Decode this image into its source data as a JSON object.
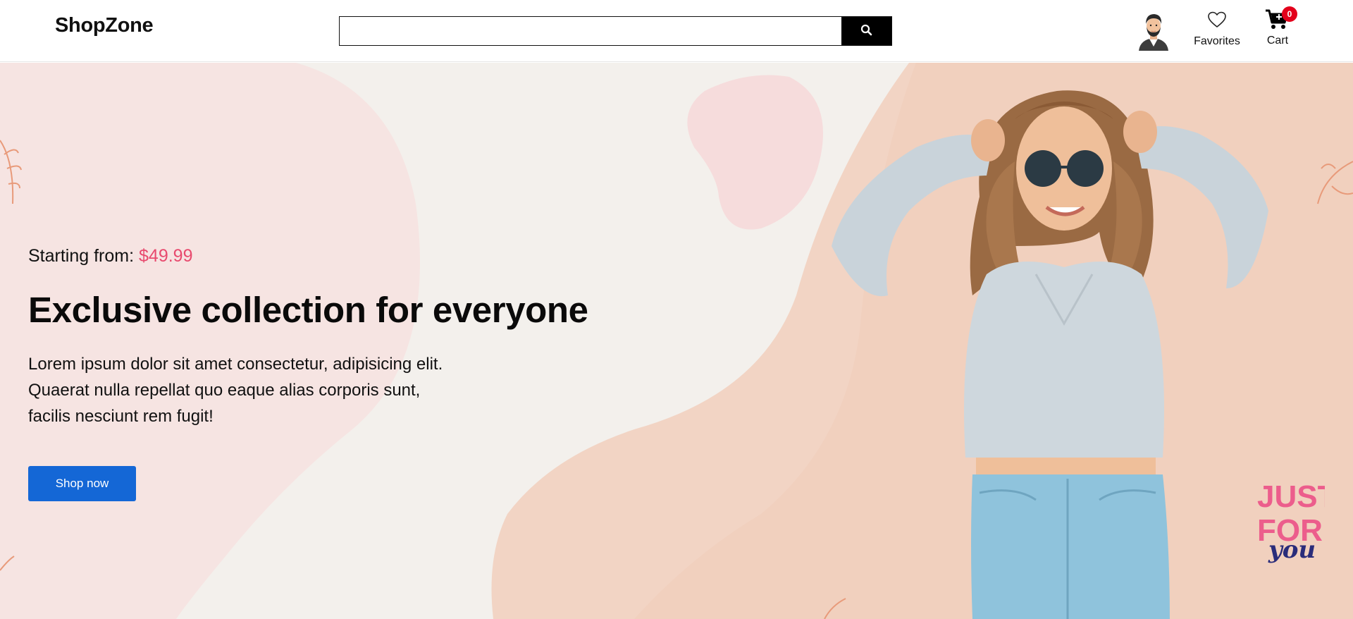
{
  "header": {
    "logo": "ShopZone",
    "search": {
      "value": "",
      "placeholder": ""
    },
    "favorites_label": "Favorites",
    "cart_label": "Cart",
    "cart_count": "0"
  },
  "hero": {
    "price_prefix": "Starting from:",
    "price": "$49.99",
    "headline": "Exclusive collection for everyone",
    "description_lines": [
      "Lorem ipsum dolor sit amet consectetur, adipisicing elit.",
      "Quaerat nulla repellat quo eaque alias corporis sunt,",
      "facilis nesciunt rem fugit!"
    ],
    "cta_label": "Shop now",
    "promo_badge": [
      "JUST",
      "FOR",
      "you"
    ]
  },
  "colors": {
    "accent_price": "#e84a6e",
    "cta_blue": "#1467d6",
    "badge_red": "#e3001b",
    "hero_bg": "#f3f0ec"
  },
  "icons": [
    "search-icon",
    "user-avatar",
    "heart-icon",
    "cart-icon"
  ]
}
